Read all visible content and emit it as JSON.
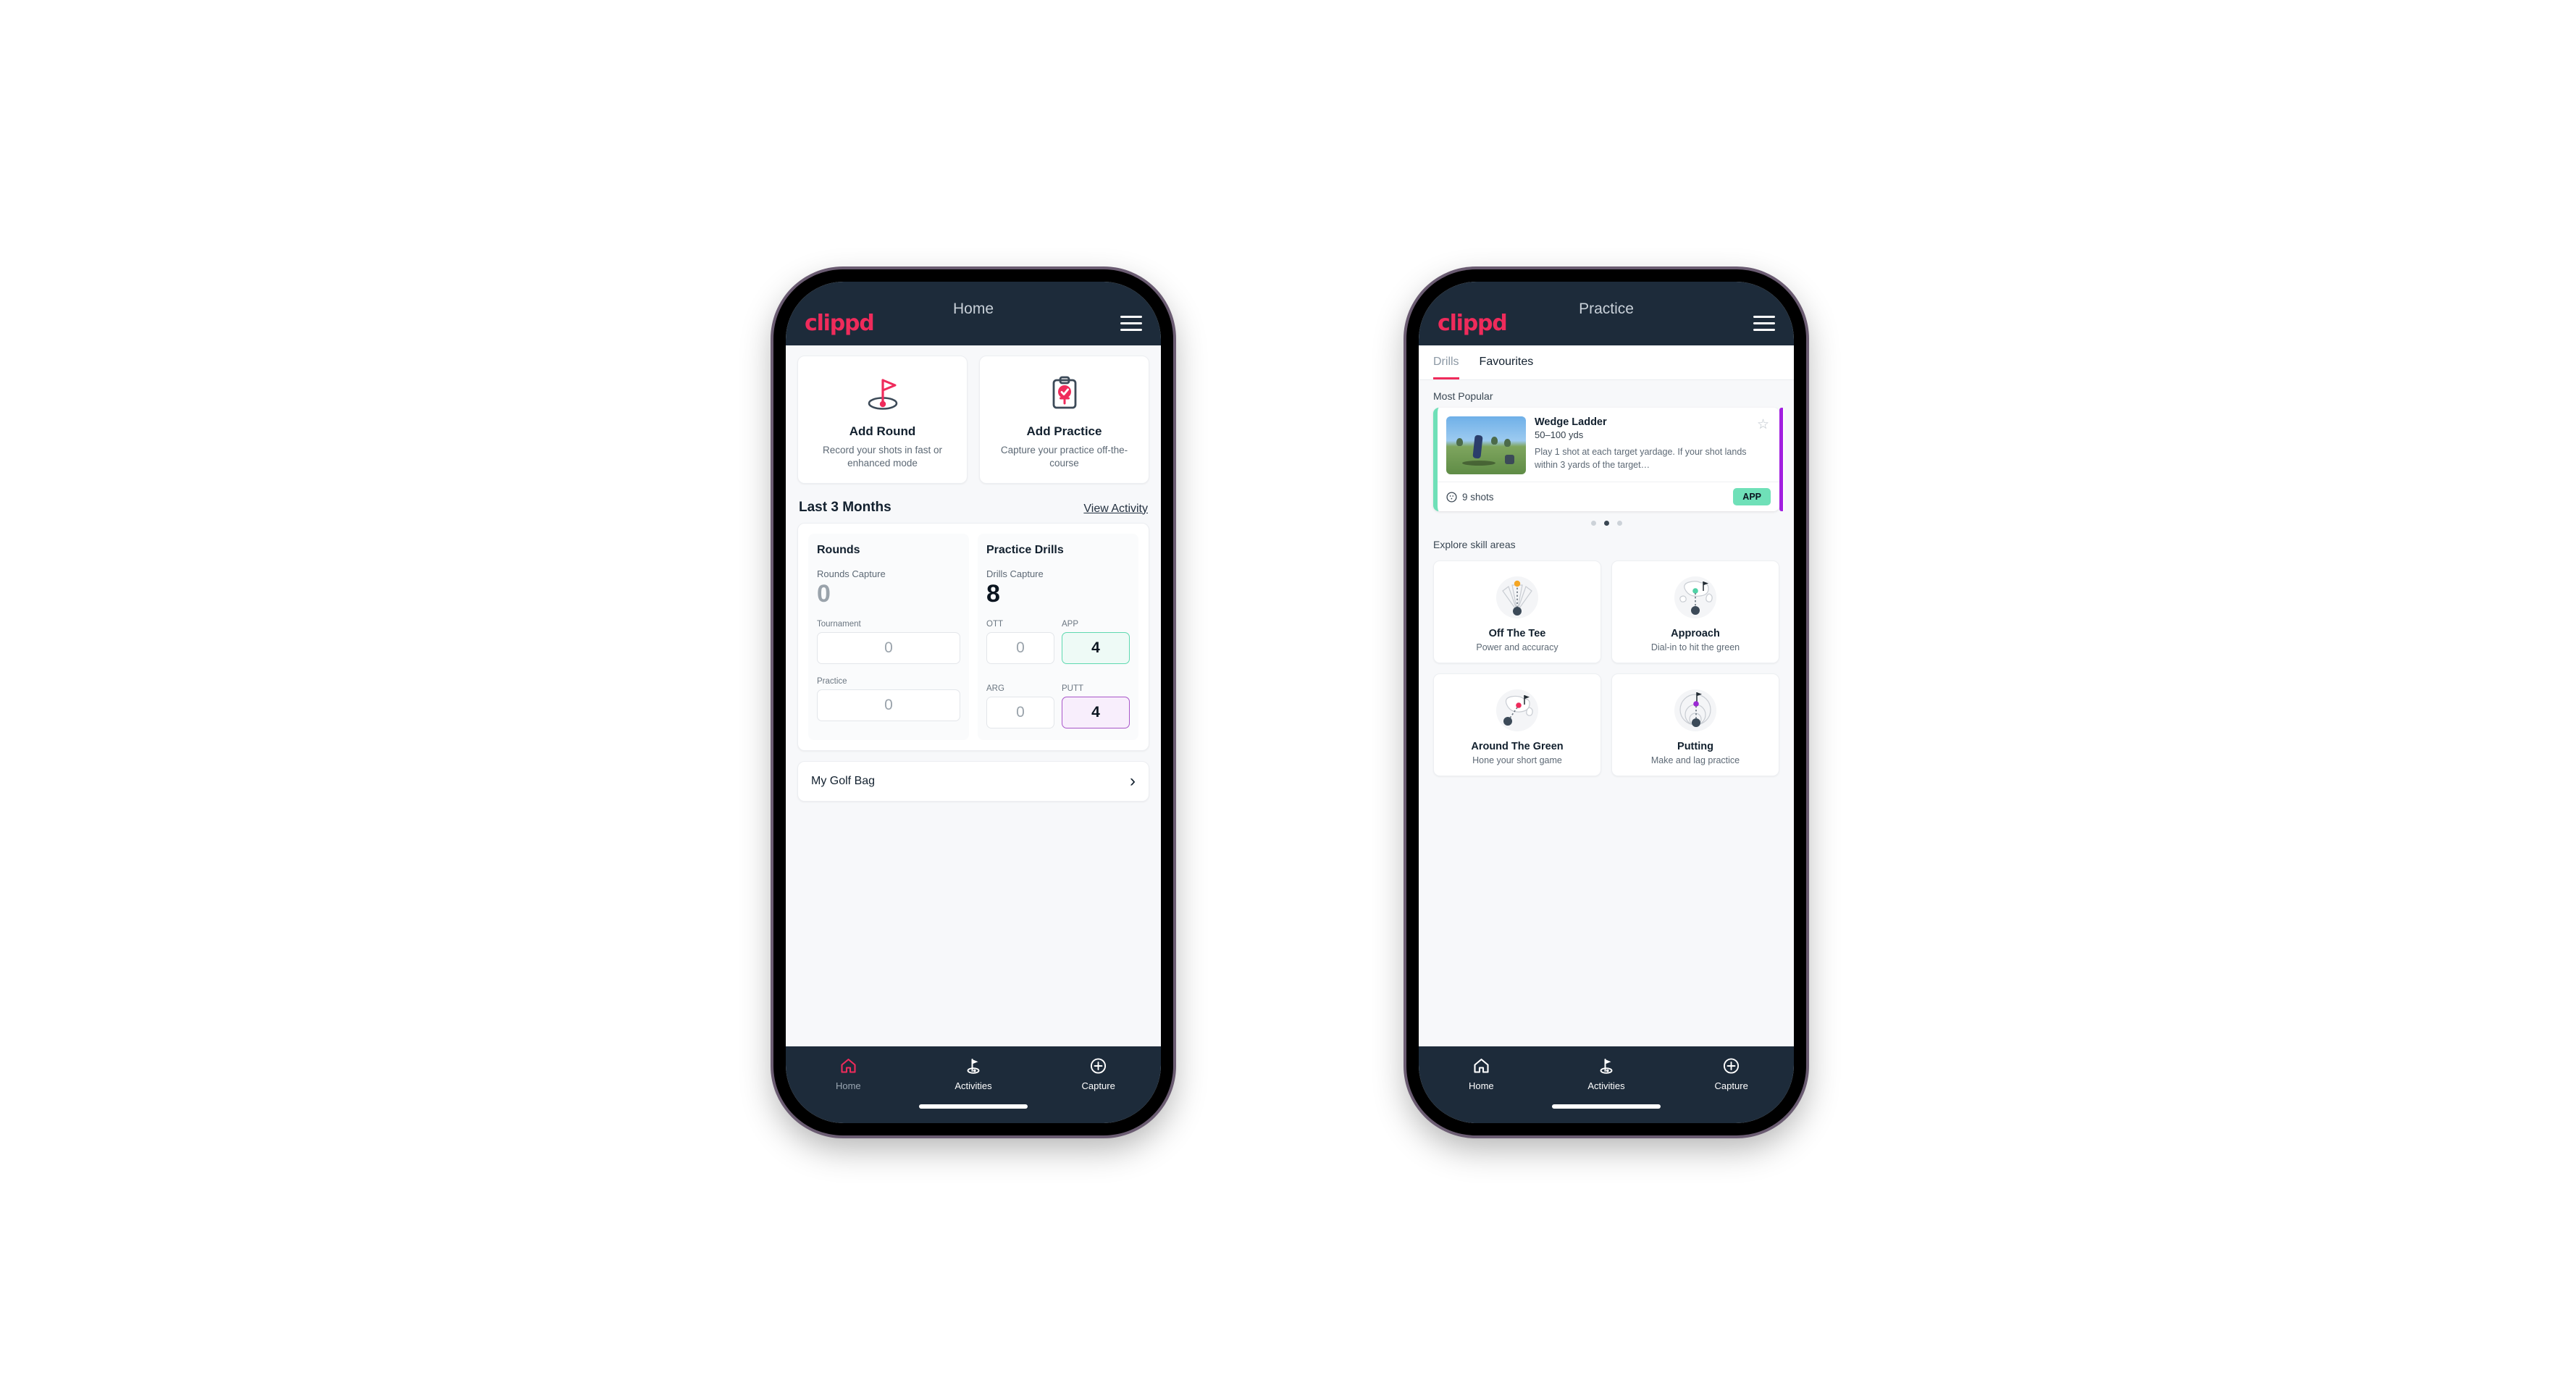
{
  "brand": {
    "logo_text": "clippd",
    "accent": "#ef2b5b",
    "appbar_bg": "#1d2b3a"
  },
  "phones": {
    "home": {
      "appbar": {
        "title": "Home",
        "menu_icon": "hamburger-menu-icon"
      },
      "quick_actions": [
        {
          "icon": "golf-flag-pin-icon",
          "title": "Add Round",
          "subtitle": "Record your shots in fast or enhanced mode"
        },
        {
          "icon": "clipboard-check-icon",
          "title": "Add Practice",
          "subtitle": "Capture your practice off-the-course"
        }
      ],
      "section": {
        "title": "Last 3 Months",
        "link": "View Activity"
      },
      "stats": {
        "rounds": {
          "heading": "Rounds",
          "capture_label": "Rounds Capture",
          "capture_value": "0",
          "fields": [
            {
              "label": "Tournament",
              "value": "0",
              "style": "plain"
            },
            {
              "label": "Practice",
              "value": "0",
              "style": "plain"
            }
          ]
        },
        "drills": {
          "heading": "Practice Drills",
          "capture_label": "Drills Capture",
          "capture_value": "8",
          "fields": [
            {
              "label": "OTT",
              "value": "0",
              "style": "plain"
            },
            {
              "label": "APP",
              "value": "4",
              "style": "green"
            },
            {
              "label": "ARG",
              "value": "0",
              "style": "plain"
            },
            {
              "label": "PUTT",
              "value": "4",
              "style": "purple"
            }
          ]
        }
      },
      "golf_bag": {
        "label": "My Golf Bag",
        "chevron": "chevron-right-icon"
      },
      "tabbar": [
        {
          "icon": "home-icon",
          "label": "Home",
          "active": true
        },
        {
          "icon": "golf-flag-icon",
          "label": "Activities",
          "active": false
        },
        {
          "icon": "plus-circle-icon",
          "label": "Capture",
          "active": false
        }
      ]
    },
    "practice": {
      "appbar": {
        "title": "Practice",
        "menu_icon": "hamburger-menu-icon"
      },
      "tabs": [
        {
          "label": "Drills",
          "active": true
        },
        {
          "label": "Favourites",
          "active": false
        }
      ],
      "most_popular_label": "Most Popular",
      "drill": {
        "title": "Wedge Ladder",
        "yardage": "50–100 yds",
        "description": "Play 1 shot at each target yardage. If your shot lands within 3 yards of the target…",
        "shots": "9 shots",
        "shots_icon": "golf-ball-icon",
        "badge": "APP",
        "badge_color": "#6fe0b8",
        "accent_color": "#6fe0b8",
        "next_accent_color": "#a21ee0",
        "favourite_icon": "star-outline-icon",
        "thumbnail": "golfer-chipping-photo"
      },
      "carousel_dots": {
        "count": 3,
        "active_index": 1
      },
      "skill_label": "Explore skill areas",
      "skills": [
        {
          "icon": "tee-shot-fan-icon",
          "name": "Off The Tee",
          "sub": "Power and accuracy",
          "dot_color": "#f5a623"
        },
        {
          "icon": "approach-green-icon",
          "name": "Approach",
          "sub": "Dial-in to hit the green",
          "dot_color": "#4fd1a5"
        },
        {
          "icon": "around-green-icon",
          "name": "Around The Green",
          "sub": "Hone your short game",
          "dot_color": "#ef2b5b"
        },
        {
          "icon": "putting-rings-icon",
          "name": "Putting",
          "sub": "Make and lag practice",
          "dot_color": "#9b28d4"
        }
      ],
      "tabbar": [
        {
          "icon": "home-icon",
          "label": "Home",
          "active": false
        },
        {
          "icon": "golf-flag-icon",
          "label": "Activities",
          "active": false
        },
        {
          "icon": "plus-circle-icon",
          "label": "Capture",
          "active": false
        }
      ]
    }
  }
}
